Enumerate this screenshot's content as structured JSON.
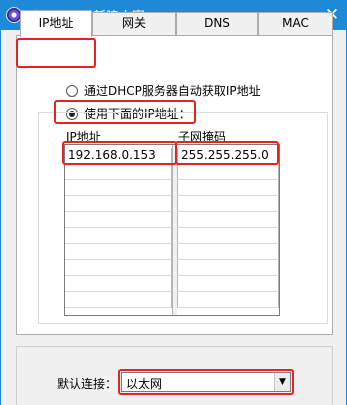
{
  "window": {
    "title": "地址配置 - 新建方案",
    "close_glyph": "✕"
  },
  "tabs": [
    {
      "label": "IP地址",
      "active": true
    },
    {
      "label": "网关",
      "active": false
    },
    {
      "label": "DNS",
      "active": false
    },
    {
      "label": "MAC",
      "active": false
    }
  ],
  "ip_mode": {
    "dhcp_label": "通过DHCP服务器自动获取IP地址",
    "static_label": "使用下面的IP地址：",
    "selected": "static"
  },
  "ip_table": {
    "headers": [
      "IP地址",
      "子网掩码"
    ],
    "rows": [
      [
        "192.168.0.153",
        "255.255.255.0"
      ],
      [
        "",
        ""
      ],
      [
        "",
        ""
      ],
      [
        "",
        ""
      ],
      [
        "",
        ""
      ],
      [
        "",
        ""
      ],
      [
        "",
        ""
      ],
      [
        "",
        ""
      ],
      [
        "",
        ""
      ],
      [
        "",
        ""
      ]
    ]
  },
  "connection": {
    "label": "默认连接：",
    "value": "以太网"
  },
  "colors": {
    "titlebar": "#1e89d6",
    "highlight": "#e8231d"
  }
}
